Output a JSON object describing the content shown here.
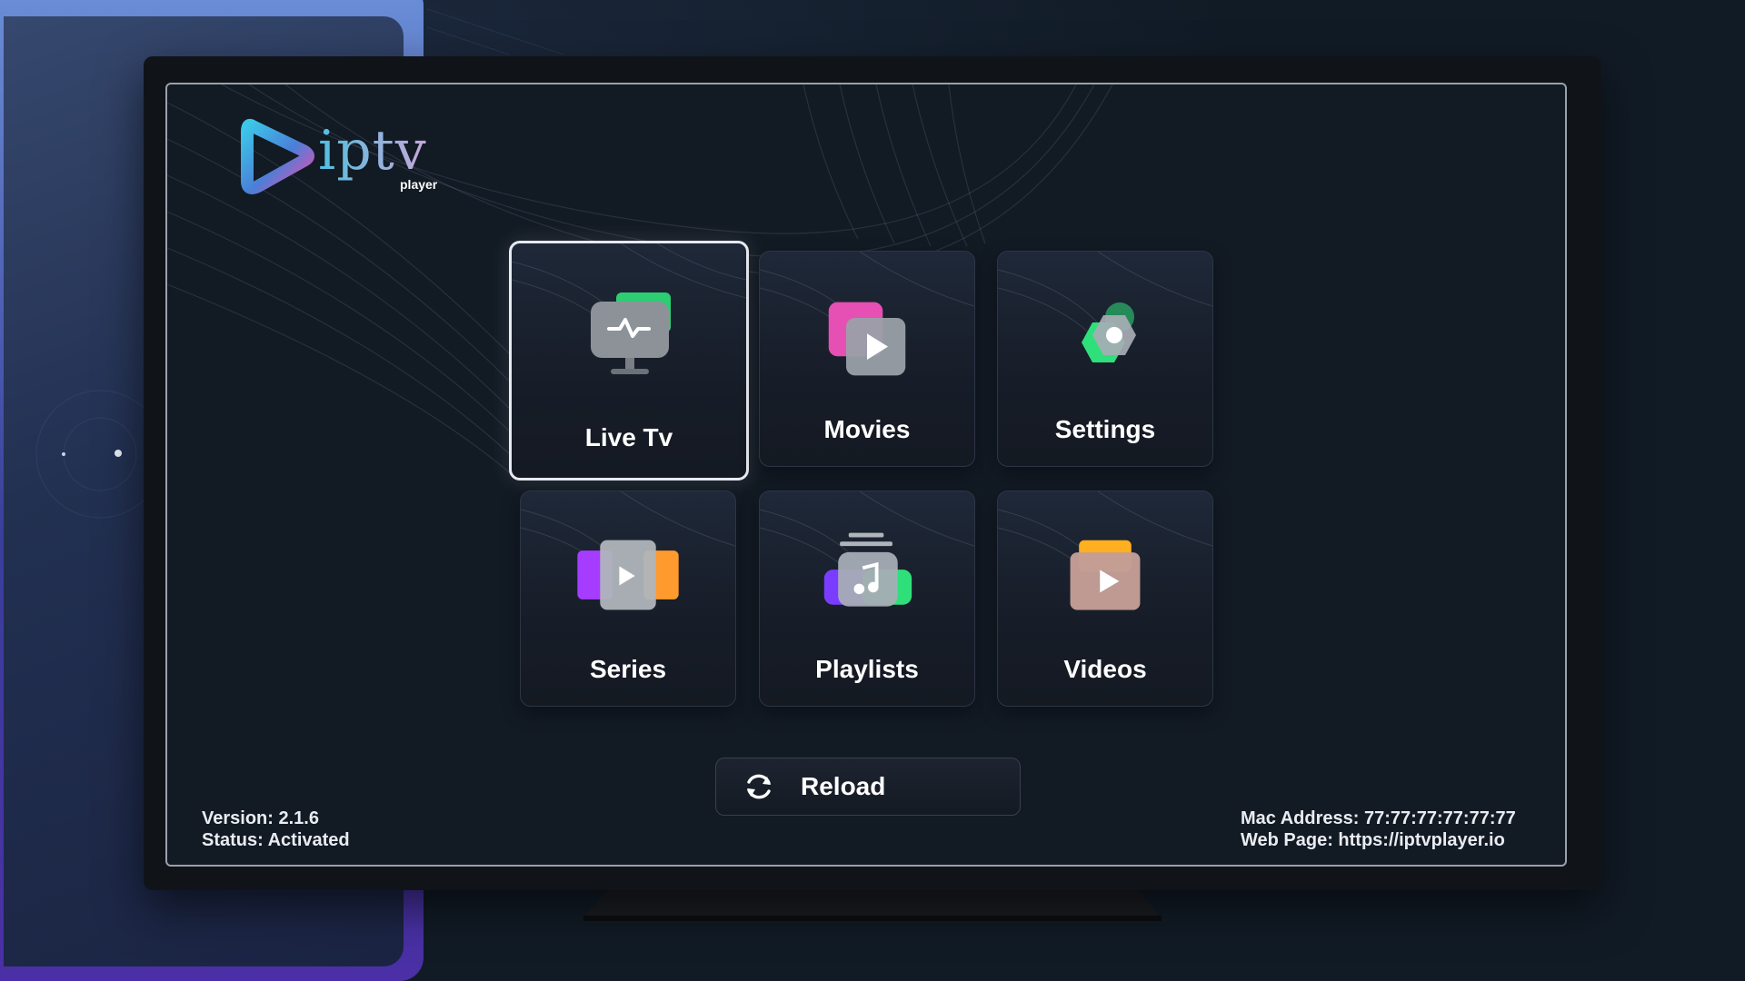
{
  "app": {
    "logo_text": "iptv",
    "logo_subtext": "player"
  },
  "menu": {
    "tiles": [
      {
        "label": "Live Tv",
        "icon": "live-tv-monitor-icon",
        "focused": true
      },
      {
        "label": "Movies",
        "icon": "movies-play-icon",
        "focused": false
      },
      {
        "label": "Settings",
        "icon": "settings-hexagon-icon",
        "focused": false
      },
      {
        "label": "Series",
        "icon": "series-play-icon",
        "focused": false
      },
      {
        "label": "Playlists",
        "icon": "playlists-music-icon",
        "focused": false
      },
      {
        "label": "Videos",
        "icon": "videos-play-icon",
        "focused": false
      }
    ]
  },
  "actions": {
    "reload_label": "Reload",
    "reload_icon": "refresh-icon"
  },
  "footer": {
    "version": "Version: 2.1.6",
    "status": "Status: Activated",
    "mac_address": "Mac Address: 77:77:77:77:77:77",
    "web_page": "Web Page: https://iptvplayer.io"
  },
  "colors": {
    "background": "#111b26",
    "screen": "#121a24",
    "accent_green": "#2fe07a",
    "accent_pink": "#e64fb3",
    "accent_orange": "#ff9a2e",
    "accent_purple": "#7a3cff",
    "logo_cyan": "#4fc0e0"
  }
}
